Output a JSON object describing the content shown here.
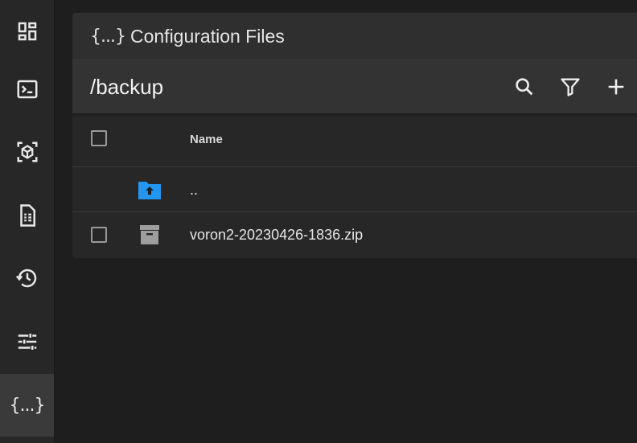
{
  "sidebar": {
    "items": [
      {
        "name": "dashboard",
        "icon": "dashboard-icon"
      },
      {
        "name": "console",
        "icon": "console-icon"
      },
      {
        "name": "objects",
        "icon": "cube-icon"
      },
      {
        "name": "gcode-files",
        "icon": "file-document-icon"
      },
      {
        "name": "history",
        "icon": "history-icon"
      },
      {
        "name": "tune",
        "icon": "tune-icon"
      },
      {
        "name": "configuration",
        "icon": "braces-icon",
        "label": "{...}",
        "active": true
      }
    ]
  },
  "header": {
    "icon_label": "{...}",
    "title": "Configuration Files"
  },
  "toolbar": {
    "path": "/backup",
    "buttons": [
      "search-icon",
      "filter-icon",
      "plus-icon"
    ]
  },
  "table": {
    "columns": {
      "name": "Name"
    },
    "rows": [
      {
        "icon": "folder-up-icon",
        "name": "..",
        "selectable": false
      },
      {
        "icon": "archive-icon",
        "name": "voron2-20230426-1836.zip",
        "selectable": true
      }
    ]
  },
  "colors": {
    "accent": "#2196f3",
    "background": "#1e1e1e",
    "card": "#272727"
  }
}
